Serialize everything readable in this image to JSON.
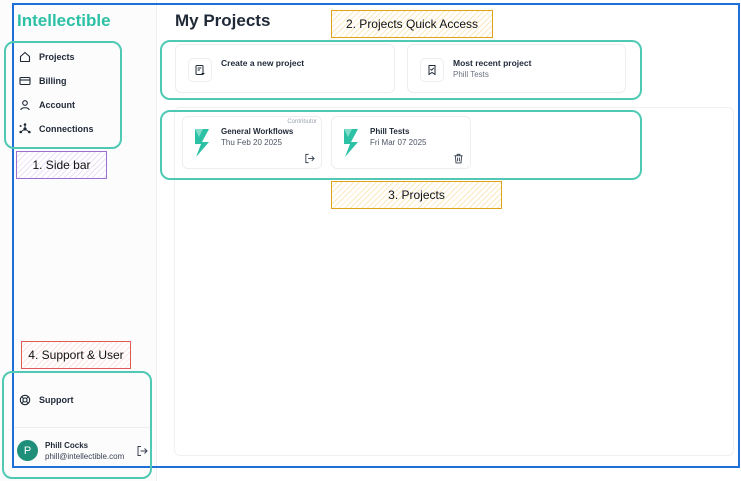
{
  "brand": "Intellectible",
  "sidebar": {
    "items": [
      {
        "label": "Projects",
        "icon": "home-icon"
      },
      {
        "label": "Billing",
        "icon": "credit-card-icon"
      },
      {
        "label": "Account",
        "icon": "user-icon"
      },
      {
        "label": "Connections",
        "icon": "connections-icon"
      }
    ],
    "support": "Support",
    "user": {
      "initial": "P",
      "name": "Phill Cocks",
      "email": "phill@intellectible.com"
    }
  },
  "main": {
    "title": "My Projects",
    "quick_access": [
      {
        "title": "Create a new project",
        "sub": "",
        "icon": "new-project-icon"
      },
      {
        "title": "Most recent project",
        "sub": "Phill Tests",
        "icon": "bookmark-check-icon"
      }
    ],
    "projects": [
      {
        "title": "General Workflows",
        "date": "Thu Feb 20 2025",
        "role": "Contributor",
        "action": "leave-icon"
      },
      {
        "title": "Phill Tests",
        "date": "Fri Mar 07 2025",
        "role": "",
        "action": "trash-icon"
      }
    ]
  },
  "annotations": {
    "sidebar": "1. Side bar",
    "quick_access": "2. Projects Quick Access",
    "projects": "3. Projects",
    "support_user": "4. Support & User"
  },
  "colors": {
    "brand": "#2cc1a5",
    "annotation_outline": "#4fc9b3",
    "frame": "#1f6fd8",
    "avatar": "#1f8f7a"
  }
}
